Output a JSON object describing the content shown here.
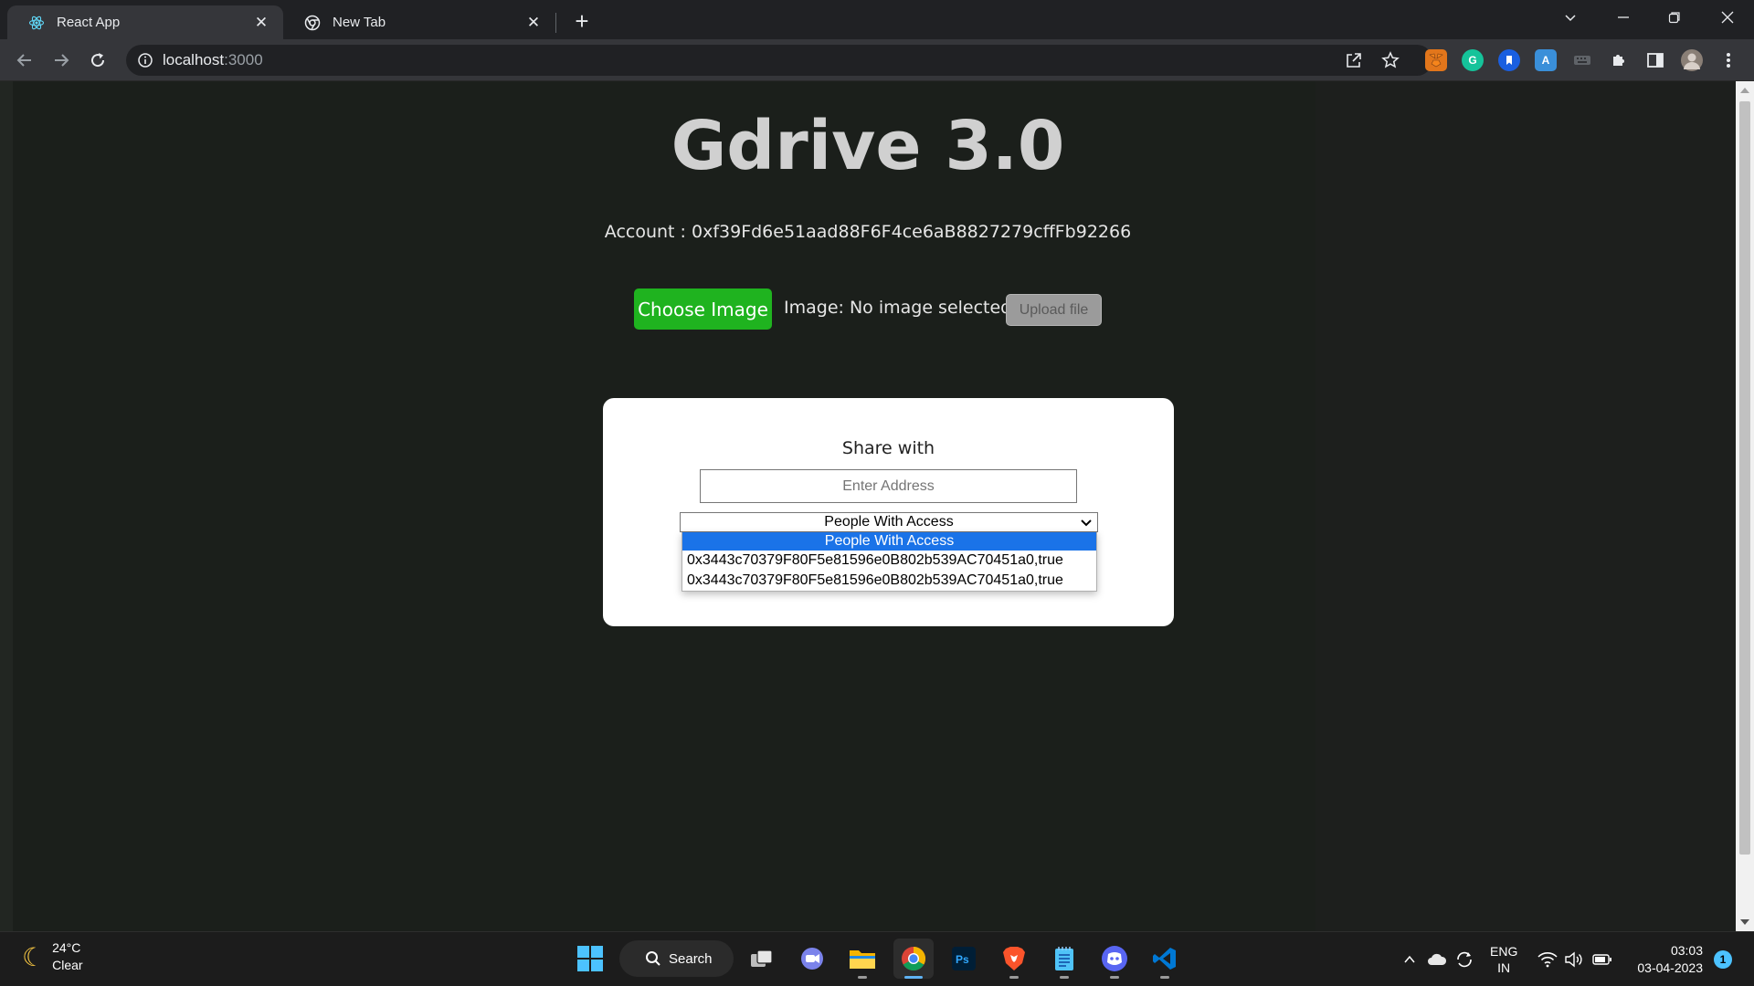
{
  "browser": {
    "tabs": [
      {
        "title": "React App",
        "icon": "react-icon"
      },
      {
        "title": "New Tab",
        "icon": "chrome-icon"
      }
    ],
    "url_host": "localhost",
    "url_port": ":3000"
  },
  "page": {
    "title": "Gdrive 3.0",
    "account": "Account : 0xf39Fd6e51aad88F6F4ce6aB8827279cffFb92266",
    "choose_button": "Choose Image",
    "image_status": "Image: No image selected",
    "upload_button": "Upload file"
  },
  "share_modal": {
    "heading": "Share with",
    "address_placeholder": "Enter Address",
    "address_value": "",
    "select_value": "People With Access",
    "options": [
      "People With Access",
      "0x3443c70379F80F5e81596e0B802b539AC70451a0,true",
      "0x3443c70379F80F5e81596e0B802b539AC70451a0,true"
    ]
  },
  "taskbar": {
    "weather_temp": "24°C",
    "weather_desc": "Clear",
    "search_label": "Search",
    "lang_top": "ENG",
    "lang_bottom": "IN",
    "time": "03:03",
    "date": "03-04-2023",
    "notification_count": "1"
  },
  "colors": {
    "choose_button": "#1fb31f",
    "page_background": "#1b1f1b",
    "selected_option": "#1a73e8"
  }
}
